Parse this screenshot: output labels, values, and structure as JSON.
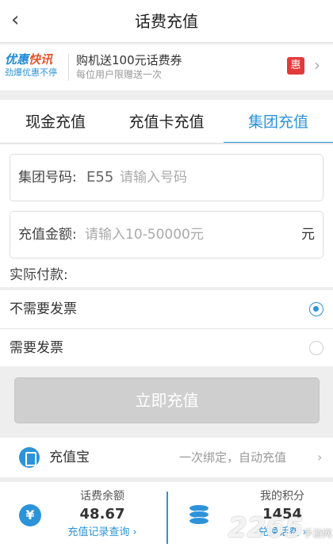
{
  "header": {
    "back_icon": "‹",
    "title": "话费充值"
  },
  "promo": {
    "brand_line1_a": "优惠",
    "brand_line1_b": "快讯",
    "brand_line2": "劲爆优惠不停",
    "title": "购机送100元话费券",
    "subtitle": "每位用户限赠送一次",
    "badge": "惠",
    "chevron": "›"
  },
  "tabs": [
    {
      "label": "现金充值"
    },
    {
      "label": "充值卡充值"
    },
    {
      "label": "集团充值",
      "active": true
    }
  ],
  "form": {
    "group_label": "集团号码:",
    "group_prefix": "E55",
    "group_placeholder": "请输入号码",
    "amount_label": "充值金额:",
    "amount_placeholder": "请输入10-50000元",
    "amount_unit": "元",
    "actual_pay_label": "实际付款:"
  },
  "invoice": {
    "options": [
      {
        "label": "不需要发票",
        "selected": true
      },
      {
        "label": "需要发票",
        "selected": false
      }
    ]
  },
  "submit_label": "立即充值",
  "recharge_treasure": {
    "icon": "phone-icon",
    "name": "充值宝",
    "desc": "一次绑定，自动充值",
    "chevron": "›"
  },
  "balance": {
    "icon": "¥",
    "label": "话费余额",
    "value": "48.67",
    "link": "充值记录查询 ›"
  },
  "points": {
    "icon": "coins-icon",
    "label": "我的积分",
    "value": "1454",
    "link": "兑换话费 ›"
  },
  "watermark": {
    "number": "2265",
    "site": "手游网"
  },
  "colors": {
    "accent": "#2c93d9",
    "disabled_button": "#cfcfcf",
    "badge_red": "#e13a3a",
    "brand_orange": "#e6552b"
  }
}
